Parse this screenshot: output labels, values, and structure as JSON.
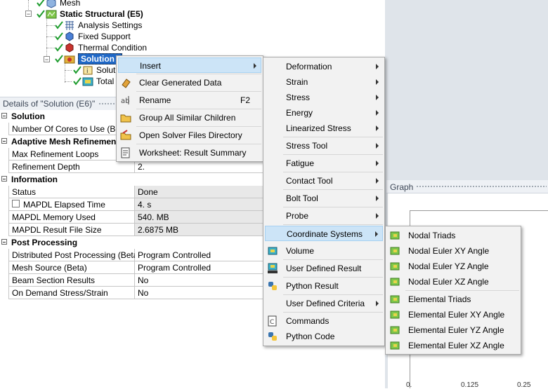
{
  "tree": {
    "mesh": "Mesh",
    "static_structural": "Static Structural (E5)",
    "analysis_settings": "Analysis Settings",
    "fixed_support": "Fixed Support",
    "thermal_condition": "Thermal Condition",
    "solution": "Solution (",
    "solution_info": "Solutio",
    "total_def": "Total D"
  },
  "details": {
    "title": "Details of \"Solution (E6)\"",
    "sections": [
      {
        "name": "Solution",
        "rows": [
          {
            "label": "Number Of Cores to Use (Beta)",
            "value": ""
          }
        ]
      },
      {
        "name": "Adaptive Mesh Refinement",
        "rows": [
          {
            "label": "Max Refinement Loops",
            "value": ""
          },
          {
            "label": "Refinement Depth",
            "value": "2."
          }
        ]
      },
      {
        "name": "Information",
        "rows": [
          {
            "label": "Status",
            "value": "Done"
          },
          {
            "label": "MAPDL Elapsed Time",
            "value": "4. s"
          },
          {
            "label": "MAPDL Memory Used",
            "value": "540. MB"
          },
          {
            "label": "MAPDL Result File Size",
            "value": "2.6875 MB"
          }
        ]
      },
      {
        "name": "Post Processing",
        "rows": [
          {
            "label": "Distributed Post Processing (Beta)",
            "value": "Program Controlled"
          },
          {
            "label": "Mesh Source (Beta)",
            "value": "Program Controlled"
          },
          {
            "label": "Beam Section Results",
            "value": "No"
          },
          {
            "label": "On Demand Stress/Strain",
            "value": "No"
          }
        ]
      }
    ]
  },
  "graph": {
    "title": "Graph",
    "ticks": [
      "0.",
      "0.125",
      "0.25"
    ]
  },
  "context_menu": {
    "items": [
      {
        "label": "Insert",
        "icon": "none",
        "submenu": true
      },
      {
        "label": "Clear Generated Data",
        "icon": "eraser-icon"
      },
      {
        "label": "Rename",
        "icon": "rename-icon",
        "shortcut": "F2"
      },
      {
        "label": "Group All Similar Children",
        "icon": "folder-icon"
      },
      {
        "label": "Open Solver Files Directory",
        "icon": "open-folder-icon"
      },
      {
        "label": "Worksheet: Result Summary",
        "icon": "worksheet-icon"
      }
    ]
  },
  "insert_menu": {
    "items": [
      {
        "label": "Deformation",
        "submenu": true
      },
      {
        "label": "Strain",
        "submenu": true
      },
      {
        "label": "Stress",
        "submenu": true
      },
      {
        "label": "Energy",
        "submenu": true
      },
      {
        "label": "Linearized Stress",
        "submenu": true
      },
      {
        "label": "Stress Tool",
        "submenu": true
      },
      {
        "label": "Fatigue",
        "submenu": true
      },
      {
        "label": "Contact Tool",
        "submenu": true
      },
      {
        "label": "Bolt Tool",
        "submenu": true
      },
      {
        "label": "Probe",
        "submenu": true
      },
      {
        "label": "Coordinate Systems",
        "submenu": true
      },
      {
        "label": "Volume",
        "icon": "volume-icon"
      },
      {
        "label": "User Defined Result",
        "icon": "user-result-icon",
        "icon_text": "USER"
      },
      {
        "label": "Python Result",
        "icon": "python-icon"
      },
      {
        "label": "User Defined Criteria",
        "submenu": true
      },
      {
        "label": "Commands",
        "icon": "commands-icon"
      },
      {
        "label": "Python Code",
        "icon": "python-code-icon"
      }
    ]
  },
  "coord_menu": {
    "items": [
      {
        "label": "Nodal Triads"
      },
      {
        "label": "Nodal Euler XY Angle"
      },
      {
        "label": "Nodal Euler YZ Angle"
      },
      {
        "label": "Nodal Euler XZ Angle"
      },
      {
        "label": "Elemental Triads"
      },
      {
        "label": "Elemental Euler XY Angle"
      },
      {
        "label": "Elemental Euler YZ Angle"
      },
      {
        "label": "Elemental Euler XZ Angle"
      }
    ]
  },
  "colors": {
    "selection": "#1f68c7",
    "menu_highlight": "#cce4f7",
    "check_green": "#1e9c2e"
  }
}
